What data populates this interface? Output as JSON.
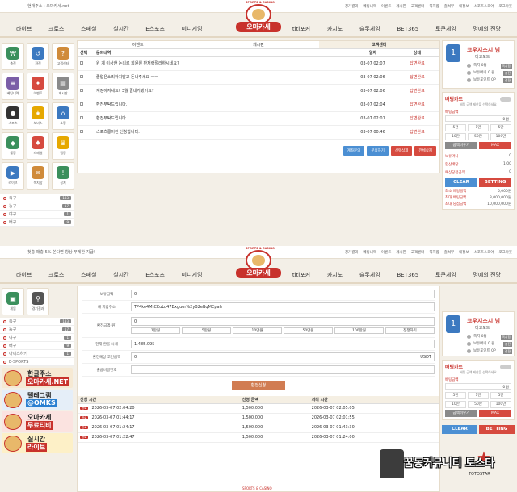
{
  "top1": {
    "notice": "현재주소 : 오마카세.net",
    "links": [
      "경기결과",
      "베팅내역",
      "이벤트",
      "게시판",
      "고객센터",
      "쪽지함",
      "출석부",
      "내정보",
      "스포츠스코어",
      "로그아웃"
    ]
  },
  "top2": {
    "notice": "첫충 매충 5% 쏜다면 항상 무제한 지급!",
    "links": [
      "경기결과",
      "베팅내역",
      "이벤트",
      "게시판",
      "고객센터",
      "쪽지함",
      "출석부",
      "내정보",
      "스포츠스코어",
      "로그아웃"
    ]
  },
  "logo": {
    "sports": "SPORTS & CASINO",
    "name": "오마카세"
  },
  "nav": [
    "라이브",
    "크로스",
    "스페셜",
    "실시간",
    "E스포츠",
    "미니게임",
    "titi포커",
    "카지노",
    "슬롯게임",
    "BET365",
    "토큰게임",
    "명예의 전당"
  ],
  "grid": [
    {
      "label": "충전",
      "icon": "charge-icon",
      "color": "#3b8f5c",
      "glyph": "₩"
    },
    {
      "label": "환전",
      "icon": "exchange-icon",
      "color": "#3c79c0",
      "glyph": "↺"
    },
    {
      "label": "고객센터",
      "icon": "support-icon",
      "color": "#d08b3a",
      "glyph": "?"
    },
    {
      "label": "베팅내역",
      "icon": "history-icon",
      "color": "#7b5ea7",
      "glyph": "≡"
    },
    {
      "label": "이벤트",
      "icon": "gift-icon",
      "color": "#d64a3f",
      "glyph": "✦"
    },
    {
      "label": "게시판",
      "icon": "board-icon",
      "color": "#8a8a8a",
      "glyph": "▤"
    },
    {
      "label": "스포츠",
      "icon": "ball-icon",
      "color": "#333",
      "glyph": "●"
    },
    {
      "label": "보너스",
      "icon": "star-icon",
      "color": "#e6a800",
      "glyph": "★"
    },
    {
      "label": "쇼핑",
      "icon": "shop-icon",
      "color": "#3c79c0",
      "glyph": "⌂"
    },
    {
      "label": "롤링",
      "icon": "roll-icon",
      "color": "#3b8f5c",
      "glyph": "◆"
    },
    {
      "label": "스페셜",
      "icon": "special-icon",
      "color": "#d64a3f",
      "glyph": "♦"
    },
    {
      "label": "랭킹",
      "icon": "crown-icon",
      "color": "#e6a800",
      "glyph": "♛"
    },
    {
      "label": "라이브",
      "icon": "live-icon",
      "color": "#3c79c0",
      "glyph": "▶"
    },
    {
      "label": "쪽지함",
      "icon": "message-icon",
      "color": "#d08b3a",
      "glyph": "✉"
    },
    {
      "label": "공지",
      "icon": "notice-icon",
      "color": "#3b8f5c",
      "glyph": "!"
    },
    {
      "label": "게임",
      "icon": "game-icon",
      "color": "#3b8f5c",
      "glyph": "▣"
    },
    {
      "label": "경기결과",
      "icon": "results-icon",
      "color": "#555",
      "glyph": "⚲"
    }
  ],
  "sports1": [
    {
      "name": "축구",
      "count": "183"
    },
    {
      "name": "농구",
      "count": "17"
    },
    {
      "name": "야구",
      "count": "1"
    },
    {
      "name": "배구",
      "count": "9"
    }
  ],
  "sports2": [
    {
      "name": "축구",
      "count": "183"
    },
    {
      "name": "농구",
      "count": "17"
    },
    {
      "name": "야구",
      "count": "1"
    },
    {
      "name": "배구",
      "count": "9"
    },
    {
      "name": "아이스하키",
      "count": "1"
    },
    {
      "name": "E-SPORTS",
      "count": ""
    }
  ],
  "tabs": [
    "이벤트",
    "게시판",
    "고객센터"
  ],
  "cs": {
    "headers": [
      "선택",
      "문의내역",
      "일자",
      "상태"
    ],
    "rows": [
      {
        "title": "원 게 이상한 논리로 회원원 환저락절라하시네요?",
        "date": "03-07 02:07",
        "status": "답변완료"
      },
      {
        "title": "졸업은소리하지말고 돈내주세요 ㅡㅡ",
        "date": "03-07 02:06",
        "status": "답변완료"
      },
      {
        "title": "계정아지세요? 3월 졸내가봤어요?",
        "date": "03-07 02:06",
        "status": "답변완료"
      },
      {
        "title": "환전부탁드립니다.",
        "date": "03-07 02:04",
        "status": "답변완료"
      },
      {
        "title": "환전부탁드립니다.",
        "date": "03-07 02:01",
        "status": "답변완료"
      },
      {
        "title": "스포츠롱이런 신청합니다.",
        "date": "03-07 00:46",
        "status": "답변완료"
      }
    ],
    "buttons": [
      "계좌문의",
      "문의하기",
      "선택삭제",
      "전체삭제"
    ]
  },
  "user": {
    "name": "코우지스시 님",
    "grade": "디코모드",
    "lines": [
      {
        "label": "쪽지 0통",
        "btn": "쪽지함"
      },
      {
        "label": "보유머니 0 원",
        "btn": "충전"
      },
      {
        "label": "보유포인트 0P",
        "btn": "전환"
      }
    ]
  },
  "bet": {
    "title": "배팅카트",
    "sub": "배팅 금액 제한을 선택하세요",
    "amount_label": "배팅금액",
    "amount": "0 원",
    "chips1": [
      "5천",
      "1만",
      "5만"
    ],
    "chips2": [
      "10만",
      "50만",
      "100만"
    ],
    "half": "금액비우기",
    "max": "MAX",
    "rows": [
      {
        "k": "보유머니",
        "v": "0"
      },
      {
        "k": "합산배당",
        "v": "1.00"
      },
      {
        "k": "예상당첨금액",
        "v": "0"
      }
    ],
    "clear": "CLEAR",
    "betting": "BETTING",
    "stats": [
      {
        "k": "최소 배팅금액",
        "v": "5,000원"
      },
      {
        "k": "최대 배팅금액",
        "v": "3,000,000원"
      },
      {
        "k": "최대 당첨금액",
        "v": "10,000,000원"
      }
    ]
  },
  "form": {
    "hold_label": "보유금액",
    "hold": "0",
    "addr_label": "내 지갑주소",
    "addr": "TP4ke4MtCEuLu47Bxguor%2yB2eBqMCpah",
    "amt_label": "환전금액(원)",
    "amt": "0",
    "chips": [
      "1만원",
      "5만원",
      "10만원",
      "50만원",
      "100만원",
      "정정하기"
    ],
    "rate_label": "현재 환율 시세",
    "rate": "1,485.095",
    "expect_label": "환전예상 코인금액",
    "expect": "0",
    "unit": "USDT",
    "pw_label": "출금비밀번호",
    "pw": "",
    "apply": "환전신청"
  },
  "history": {
    "headers": [
      "신청 시간",
      "신청 금액",
      "처리 시간"
    ],
    "rows": [
      {
        "tag": "완료",
        "time": "2026-03-07 02:04:20",
        "amount": "1,500,000",
        "done": "2026-03-07 02:05:05"
      },
      {
        "tag": "완료",
        "time": "2026-03-07 01:44:17",
        "amount": "1,500,000",
        "done": "2026-03-07 02:01:55"
      },
      {
        "tag": "완료",
        "time": "2026-03-07 01:24:17",
        "amount": "1,500,000",
        "done": "2026-03-07 01:43:30"
      },
      {
        "tag": "완료",
        "time": "2026-03-07 01:22:47",
        "amount": "1,500,000",
        "done": "2026-03-07 01:24:00"
      }
    ]
  },
  "banners": [
    {
      "l1": "한글주소",
      "l2": "오마카세.NET",
      "bg": "#f6e9d3",
      "c1": "#222",
      "c2bg": "#c8322c",
      "c2": "#fff"
    },
    {
      "l1": "텔레그램",
      "l2": "@OMKS",
      "bg": "#e5eef8",
      "c1": "#222",
      "c2bg": "#2a7fd1",
      "c2": "#fff"
    },
    {
      "l1": "오마카세",
      "l2": "무료티비",
      "bg": "#fbe3e0",
      "c1": "#222",
      "c2bg": "#c8322c",
      "c2": "#fff"
    },
    {
      "l1": "실시간",
      "l2": "라이브",
      "bg": "#fdf0c7",
      "c1": "#222",
      "c2bg": "#c8322c",
      "c2": "#fff"
    }
  ],
  "watermark": {
    "text": "꿈동커뮤니티 토스타",
    "sub": "TOTOSTAR"
  },
  "bottom_logo": "SPORTS & CASINO",
  "user2_name": "코우지스시 님"
}
